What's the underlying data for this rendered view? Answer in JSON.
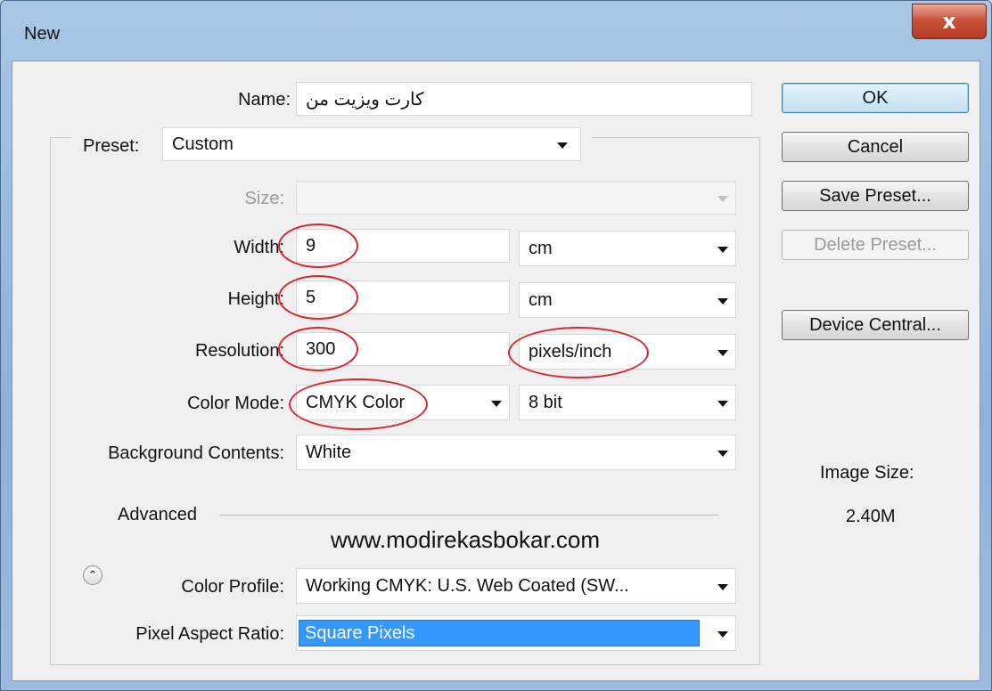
{
  "window": {
    "title": "New",
    "close_glyph": "x"
  },
  "form": {
    "name_label": "Name:",
    "name_value": "کارت ویزیت من",
    "preset_label": "Preset:",
    "preset_value": "Custom",
    "size_label": "Size:",
    "size_value": "",
    "width_label": "Width:",
    "width_value": "9",
    "width_unit": "cm",
    "height_label": "Height:",
    "height_value": "5",
    "height_unit": "cm",
    "resolution_label": "Resolution:",
    "resolution_value": "300",
    "resolution_unit": "pixels/inch",
    "color_mode_label": "Color Mode:",
    "color_mode_value": "CMYK Color",
    "bit_depth_value": "8 bit",
    "background_label": "Background Contents:",
    "background_value": "White",
    "advanced_label": "Advanced",
    "color_profile_label": "Color Profile:",
    "color_profile_value": "Working CMYK:  U.S. Web Coated (SW...",
    "pixel_aspect_label": "Pixel Aspect Ratio:",
    "pixel_aspect_value": "Square Pixels"
  },
  "buttons": {
    "ok": "OK",
    "cancel": "Cancel",
    "save_preset": "Save Preset...",
    "delete_preset": "Delete Preset...",
    "device_central": "Device Central..."
  },
  "image_size": {
    "label": "Image Size:",
    "value": "2.40M"
  },
  "watermark": "www.modirekasbokar.com",
  "colors": {
    "highlight_oval": "#d9262a",
    "selection": "#3399ff"
  }
}
